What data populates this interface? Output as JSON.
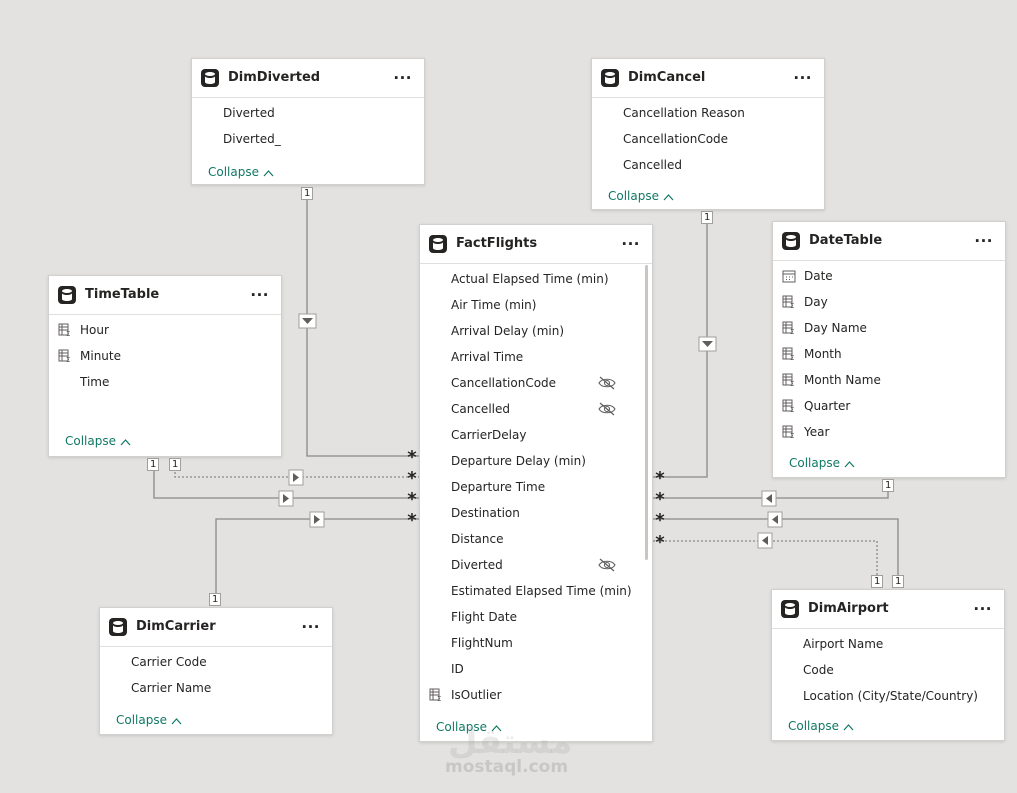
{
  "tables": {
    "dimdiverted": {
      "name": "DimDiverted",
      "fields": [
        "Diverted",
        "Diverted_"
      ],
      "collapse": "Collapse"
    },
    "dimcancel": {
      "name": "DimCancel",
      "fields": [
        "Cancellation Reason",
        "CancellationCode",
        "Cancelled"
      ],
      "collapse": "Collapse"
    },
    "timetable": {
      "name": "TimeTable",
      "fields": [
        "Hour",
        "Minute",
        "Time"
      ],
      "collapse": "Collapse"
    },
    "facts": {
      "name": "FactFlights",
      "fields": [
        "Actual Elapsed Time (min)",
        "Air Time (min)",
        "Arrival Delay (min)",
        "Arrival Time",
        "CancellationCode",
        "Cancelled",
        "CarrierDelay",
        "Departure Delay (min)",
        "Departure Time",
        "Destination",
        "Distance",
        "Diverted",
        "Estimated Elapsed Time (min)",
        "Flight Date",
        "FlightNum",
        "ID",
        "IsOutlier"
      ],
      "collapse": "Collapse"
    },
    "datetable": {
      "name": "DateTable",
      "fields": [
        "Date",
        "Day",
        "Day Name",
        "Month",
        "Month Name",
        "Quarter",
        "Year"
      ],
      "collapse": "Collapse"
    },
    "dimcarrier": {
      "name": "DimCarrier",
      "fields": [
        "Carrier Code",
        "Carrier Name"
      ],
      "collapse": "Collapse"
    },
    "dimairport": {
      "name": "DimAirport",
      "fields": [
        "Airport Name",
        "Code",
        "Location (City/State/Country)"
      ],
      "collapse": "Collapse"
    }
  },
  "menu": "...",
  "cardinality": {
    "one": "1",
    "many": "*"
  },
  "watermark": {
    "text": "mostaql.com",
    "logo": "مستقل"
  },
  "colors": {
    "canvas": "#e3e2e0",
    "line": "#8a8886",
    "accent": "#117865"
  }
}
